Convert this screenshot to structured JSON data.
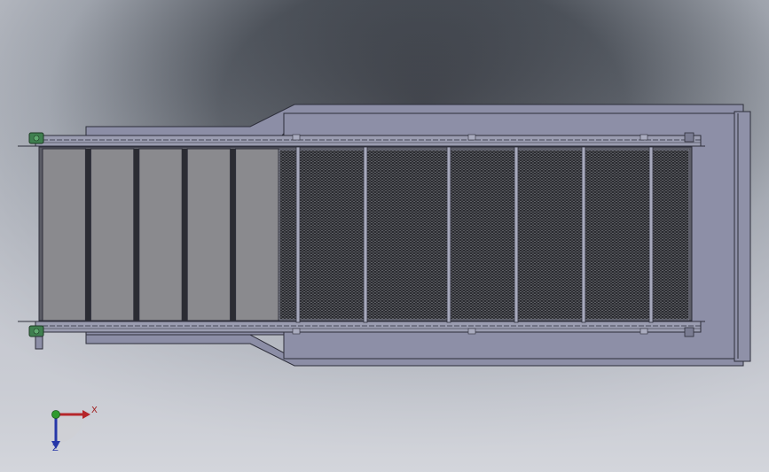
{
  "triad": {
    "x_label": "X",
    "z_label": "Z",
    "colors": {
      "x_axis": "#b5262a",
      "y_axis": "#2f9a2f",
      "z_axis": "#2637a8",
      "label": "#a02020"
    }
  },
  "colors": {
    "background_top": "#9aa1ab",
    "background_dark": "#3b4048",
    "background_bottom": "#c9ccd3",
    "frame_fill": "#8d8fa6",
    "frame_edge": "#2d2e3a",
    "belt_plate": "#8a8a8e",
    "belt_mesh": "#2b2c31",
    "mesh_dot": "#8f9096",
    "sprocket": "#3f7f4f"
  },
  "drawing": {
    "solid_plate_count": 5,
    "mesh_panel_count": 7
  }
}
